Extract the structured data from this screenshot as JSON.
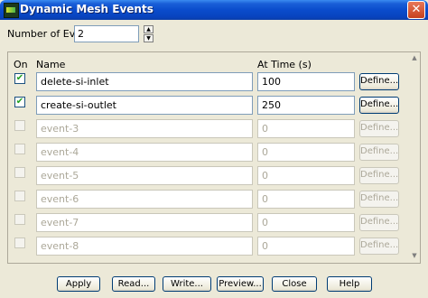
{
  "window": {
    "title": "Dynamic Mesh Events",
    "close_glyph": "✕"
  },
  "num_events": {
    "label": "Number of Events",
    "value": "2"
  },
  "table": {
    "col_on": "On",
    "col_name": "Name",
    "col_time": "At Time (s)",
    "rows": [
      {
        "on": true,
        "name": "delete-si-inlet",
        "time": "100",
        "define": "Define...",
        "enabled": true
      },
      {
        "on": true,
        "name": "create-si-outlet",
        "time": "250",
        "define": "Define...",
        "enabled": true
      },
      {
        "on": false,
        "name": "event-3",
        "time": "0",
        "define": "Define...",
        "enabled": false
      },
      {
        "on": false,
        "name": "event-4",
        "time": "0",
        "define": "Define...",
        "enabled": false
      },
      {
        "on": false,
        "name": "event-5",
        "time": "0",
        "define": "Define...",
        "enabled": false
      },
      {
        "on": false,
        "name": "event-6",
        "time": "0",
        "define": "Define...",
        "enabled": false
      },
      {
        "on": false,
        "name": "event-7",
        "time": "0",
        "define": "Define...",
        "enabled": false
      },
      {
        "on": false,
        "name": "event-8",
        "time": "0",
        "define": "Define...",
        "enabled": false
      }
    ]
  },
  "buttons": {
    "apply": "Apply",
    "read": "Read...",
    "write": "Write...",
    "preview": "Preview...",
    "close": "Close",
    "help": "Help"
  },
  "icons": {
    "app": "fluent-app-icon",
    "check": "✔",
    "spin_up": "▲",
    "spin_down": "▼",
    "scroll_up": "▲",
    "scroll_down": "▼"
  }
}
